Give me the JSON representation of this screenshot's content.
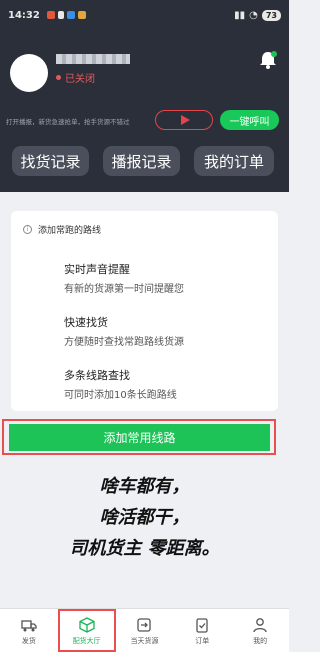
{
  "status_bar": {
    "time": "14:32",
    "battery": "73"
  },
  "profile": {
    "status": "已关闭"
  },
  "top": {
    "notice": "打开播报，新货急速抢单，抢手货源不错过",
    "call_label": "一键呼叫"
  },
  "quick_links": [
    "找货记录",
    "播报记录",
    "我的订单"
  ],
  "card": {
    "heading": "添加常跑的路线",
    "features": [
      {
        "title": "实时声音提醒",
        "desc": "有新的货源第一时间提醒您"
      },
      {
        "title": "快速找货",
        "desc": "方便随时查找常跑路线货源"
      },
      {
        "title": "多条线路查找",
        "desc": "可同时添加10条长跑路线"
      }
    ]
  },
  "add_button": "添加常用线路",
  "slogan": [
    "啥车都有，",
    "啥活都干，",
    "司机货主 零距离。"
  ],
  "tabs": [
    {
      "label": "发货",
      "icon": "truck-icon",
      "active": false
    },
    {
      "label": "配货大厅",
      "icon": "package-icon",
      "active": true
    },
    {
      "label": "当天货源",
      "icon": "export-icon",
      "active": false
    },
    {
      "label": "订单",
      "icon": "clipboard-icon",
      "active": false
    },
    {
      "label": "我的",
      "icon": "person-icon",
      "active": false
    }
  ],
  "colors": {
    "accent": "#1ec357",
    "header_bg": "#2b2f3a",
    "alert": "#e3454a"
  }
}
